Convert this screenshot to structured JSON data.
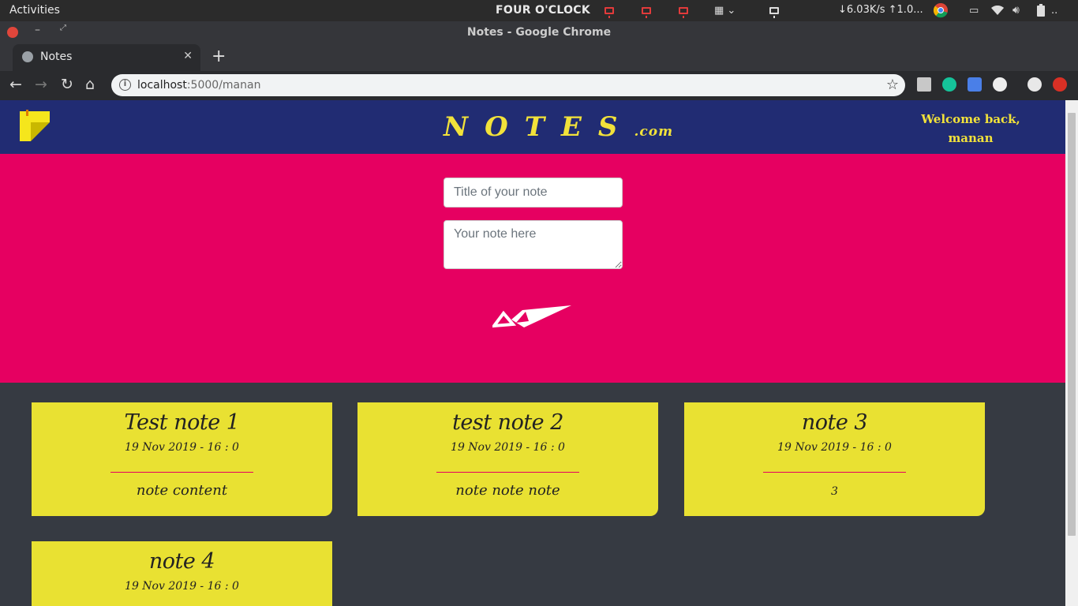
{
  "system": {
    "activities": "Activities",
    "clock": "FOUR O'CLOCK",
    "netspeed": "↓6.03K/s ↑1.0...",
    "battery_extra": ".."
  },
  "browser": {
    "window_title": "Notes - Google Chrome",
    "tab_title": "Notes",
    "url_host": "localhost",
    "url_path": ":5000/manan"
  },
  "header": {
    "brand_big": "NOTES",
    "brand_small": ".com",
    "welcome_line1": "Welcome back,",
    "welcome_line2": "manan"
  },
  "form": {
    "title_placeholder": "Title of your note",
    "note_placeholder": "Your note here"
  },
  "notes": [
    {
      "title": "Test note 1",
      "date": "19 Nov 2019 - 16 : 0",
      "content": "note content"
    },
    {
      "title": "test note 2",
      "date": "19 Nov 2019 - 16 : 0",
      "content": "note note note"
    },
    {
      "title": "note 3",
      "date": "19 Nov 2019 - 16 : 0",
      "content": "3"
    },
    {
      "title": "note 4",
      "date": "19 Nov 2019 - 16 : 0",
      "content": ""
    }
  ],
  "colors": {
    "header_bg": "#212c73",
    "form_bg": "#e60061",
    "page_bg": "#363a42",
    "card_bg": "#e9e132",
    "brand_text": "#f2e23a"
  }
}
